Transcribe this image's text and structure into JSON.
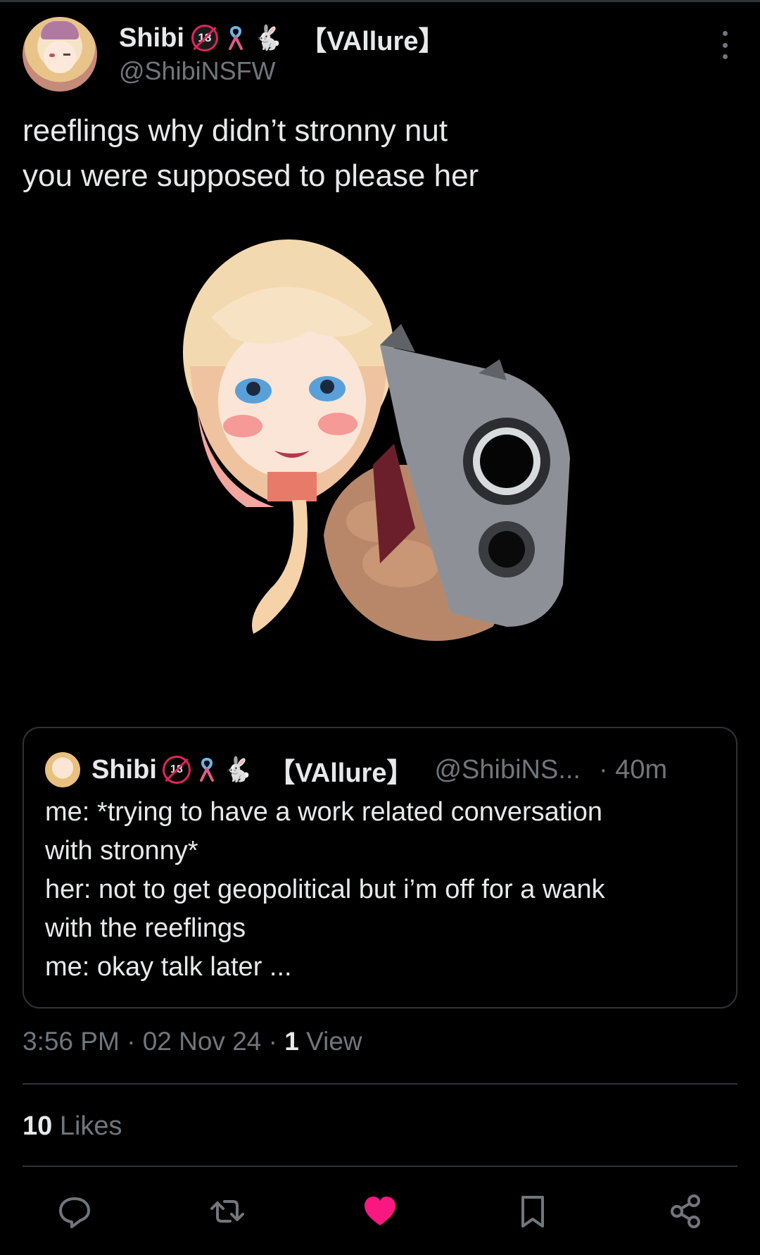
{
  "tweet": {
    "author": {
      "display_name": "Shibi",
      "badge_text": "18",
      "badge_super": "UNDER",
      "emoji_rabbit": "🐇",
      "affiliation": "【VAllure】",
      "handle": "@ShibiNSFW"
    },
    "text_lines": [
      "reeflings why didn’t stronny nut",
      "you were supposed to please her"
    ],
    "quote": {
      "display_name": "Shibi",
      "badge_text": "18",
      "emoji_rabbit": "🐇",
      "affiliation": "【VAllure】",
      "handle": "@ShibiNS...",
      "time": "· 40m",
      "lines": [
        "me: *trying to have a work related conversation",
        "with stronny*",
        "her: not to get geopolitical but i’m off for a wank",
        "with the reeflings",
        "me: okay talk later ..."
      ]
    },
    "meta": {
      "time": "3:56 PM",
      "date": "02 Nov 24",
      "views_count": "1",
      "views_label": "View",
      "sep": " · "
    },
    "likes": {
      "count": "10",
      "label": "Likes"
    }
  },
  "actions": [
    {
      "name": "reply-icon"
    },
    {
      "name": "repost-icon"
    },
    {
      "name": "like-icon",
      "color": "#f91880"
    },
    {
      "name": "bookmark-icon"
    },
    {
      "name": "share-icon"
    }
  ],
  "colors": {
    "background": "#000000",
    "text": "#e7e9ea",
    "secondary": "#71767b",
    "divider": "#2f3336",
    "like_active": "#f91880"
  }
}
